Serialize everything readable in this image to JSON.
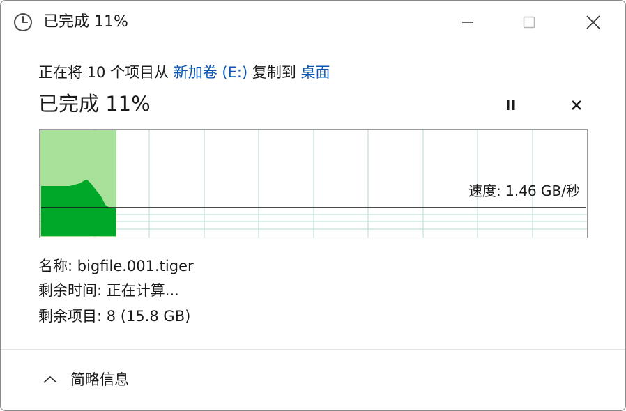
{
  "window": {
    "title": "已完成 11%"
  },
  "header": {
    "prefix": "正在将 10 个项目从 ",
    "source": "新加卷 (E:)",
    "middle": " 复制到 ",
    "destination": "桌面"
  },
  "progress": {
    "status": "已完成 11%",
    "percent": 11,
    "speed_label": "速度: 1.46 GB/秒"
  },
  "details": {
    "name_label": "名称:",
    "name_value": "bigfile.001.tiger",
    "time_label": "剩余时间:",
    "time_value": "正在计算...",
    "items_label": "剩余项目:",
    "items_value": "8 (15.8 GB)"
  },
  "footer": {
    "toggle_label": "简略信息"
  },
  "colors": {
    "accent_link": "#0a56b8",
    "progress_light": "#a8e29a",
    "progress_dark": "#00a82a",
    "grid": "#b8d8d0"
  },
  "icons": {
    "title": "clock-icon",
    "minimize": "minimize-icon",
    "maximize": "maximize-icon",
    "close": "close-icon",
    "pause": "pause-icon",
    "cancel": "cancel-icon",
    "collapse": "chevron-up-icon"
  }
}
